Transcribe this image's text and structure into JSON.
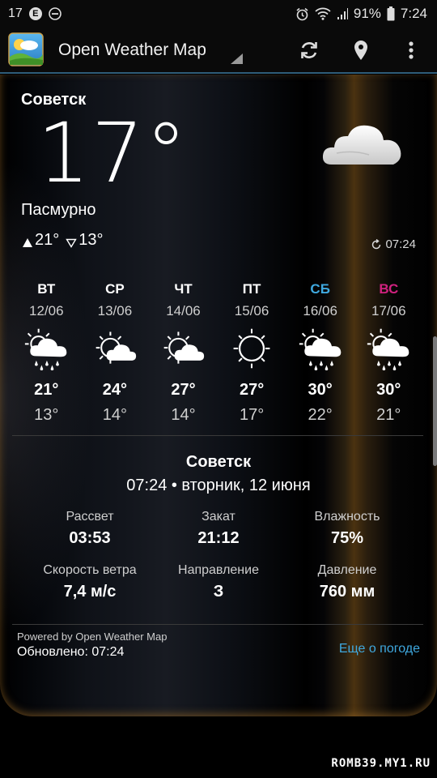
{
  "status_bar": {
    "notif_count": "17",
    "badge_letter": "E",
    "battery": "91%",
    "time": "7:24",
    "icons": [
      "alarm-icon",
      "wifi-icon",
      "signal-icon",
      "battery-icon",
      "do-not-disturb-icon"
    ]
  },
  "app_bar": {
    "title": "Open Weather Map",
    "actions": [
      "refresh-icon",
      "location-pin-icon",
      "overflow-menu-icon"
    ]
  },
  "current": {
    "city": "Советск",
    "temperature": "17°",
    "condition": "Пасмурно",
    "high": "21°",
    "low": "13°",
    "updated_time": "07:24",
    "icon": "cloudy-icon"
  },
  "forecast": [
    {
      "day": "ВТ",
      "date": "12/06",
      "icon": "rain-icon",
      "high": "21°",
      "low": "13°",
      "color": "#ffffff"
    },
    {
      "day": "СР",
      "date": "13/06",
      "icon": "partly-cloudy-icon",
      "high": "24°",
      "low": "14°",
      "color": "#ffffff"
    },
    {
      "day": "ЧТ",
      "date": "14/06",
      "icon": "partly-cloudy-icon",
      "high": "27°",
      "low": "14°",
      "color": "#ffffff"
    },
    {
      "day": "ПТ",
      "date": "15/06",
      "icon": "sunny-icon",
      "high": "27°",
      "low": "17°",
      "color": "#ffffff"
    },
    {
      "day": "СБ",
      "date": "16/06",
      "icon": "rain-icon",
      "high": "30°",
      "low": "22°",
      "color": "#3fa9e0"
    },
    {
      "day": "ВС",
      "date": "17/06",
      "icon": "rain-icon",
      "high": "30°",
      "low": "21°",
      "color": "#d0217f"
    }
  ],
  "details": {
    "city": "Советск",
    "datetime": "07:24 • вторник, 12 июня",
    "items": [
      {
        "label": "Рассвет",
        "value": "03:53"
      },
      {
        "label": "Закат",
        "value": "21:12"
      },
      {
        "label": "Влажность",
        "value": "75%"
      },
      {
        "label": "Скорость ветра",
        "value": "7,4 м/с"
      },
      {
        "label": "Направление",
        "value": "З"
      },
      {
        "label": "Давление",
        "value": "760 мм"
      }
    ]
  },
  "footer": {
    "powered": "Powered by Open Weather Map",
    "updated": "Обновлено: 07:24",
    "more_link": "Еще о погоде"
  },
  "watermark": "ROMB39.MY1.RU"
}
